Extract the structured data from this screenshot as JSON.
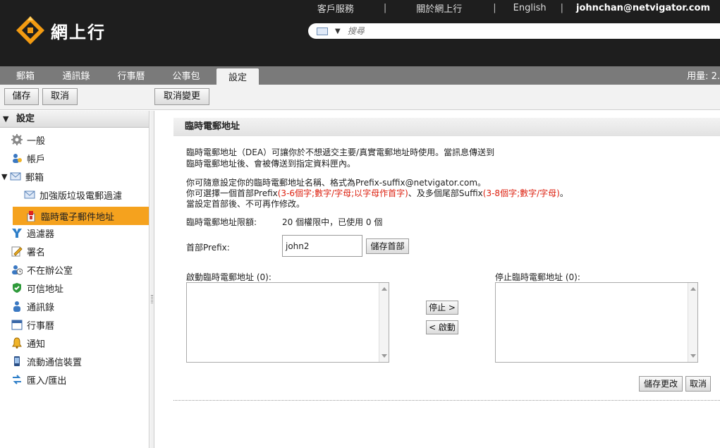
{
  "header": {
    "links": [
      "客戶服務",
      "關於網上行",
      "English",
      "johnchan@netvigator.com"
    ],
    "logo_text": "網上行",
    "search_placeholder": "搜尋"
  },
  "tabs": [
    "郵箱",
    "通訊錄",
    "行事曆",
    "公事包",
    "設定"
  ],
  "active_tab": "設定",
  "usage_label": "用量:  2.",
  "toolbar": {
    "save": "儲存",
    "cancel": "取消",
    "undo": "取消變更"
  },
  "sidebar": {
    "heading": "設定",
    "items": [
      {
        "label": "一般",
        "icon": "gear-icon"
      },
      {
        "label": "帳戶",
        "icon": "account-icon"
      },
      {
        "label": "郵箱",
        "icon": "mail-icon"
      },
      {
        "label": "加強版垃圾電郵過濾",
        "icon": "mail-icon"
      },
      {
        "label": "臨時電子郵件地址",
        "icon": "mailbox-icon"
      },
      {
        "label": "過濾器",
        "icon": "filter-icon"
      },
      {
        "label": "署名",
        "icon": "signature-icon"
      },
      {
        "label": "不在辦公室",
        "icon": "away-icon"
      },
      {
        "label": "可信地址",
        "icon": "shield-icon"
      },
      {
        "label": "通訊錄",
        "icon": "contacts-icon"
      },
      {
        "label": "行事曆",
        "icon": "calendar-icon"
      },
      {
        "label": "通知",
        "icon": "bell-icon"
      },
      {
        "label": "流動通信裝置",
        "icon": "mobile-icon"
      },
      {
        "label": "匯入/匯出",
        "icon": "import-export-icon"
      }
    ]
  },
  "main": {
    "title": "臨時電郵地址",
    "intro_line1": "臨時電郵地址（DEA）可讓你於不想遞交主要/真實電郵地址時使用。當訊息傳送到",
    "intro_line2": "臨時電郵地址後、會被傳送到指定資料匣內。",
    "rule_line1": "你可隨意設定你的臨時電郵地址名稱、格式為Prefix-suffix@netvigator.com。",
    "rule_line2a": "你可選擇一個首部Prefix",
    "rule_line2b": "(3-6個字;數字/字母;以字母作首字)",
    "rule_line2c": "、及多個尾部Suffix",
    "rule_line2d": "(3-8個字;數字/字母)",
    "rule_line2e": "。",
    "rule_line3": "當設定首部後、不可再作修改。",
    "quota_label": "臨時電郵地址限額:",
    "quota_value": "20 個權限中，已使用 0 個",
    "prefix_label": "首部Prefix:",
    "prefix_value": "john2",
    "save_prefix": "儲存首部",
    "active_label": "啟動臨時電郵地址 (0):",
    "inactive_label": "停止臨時電郵地址 (0):",
    "stop_btn": "停止 >",
    "start_btn": "< 啟動",
    "save_changes": "儲存更改",
    "cancel": "取消"
  }
}
